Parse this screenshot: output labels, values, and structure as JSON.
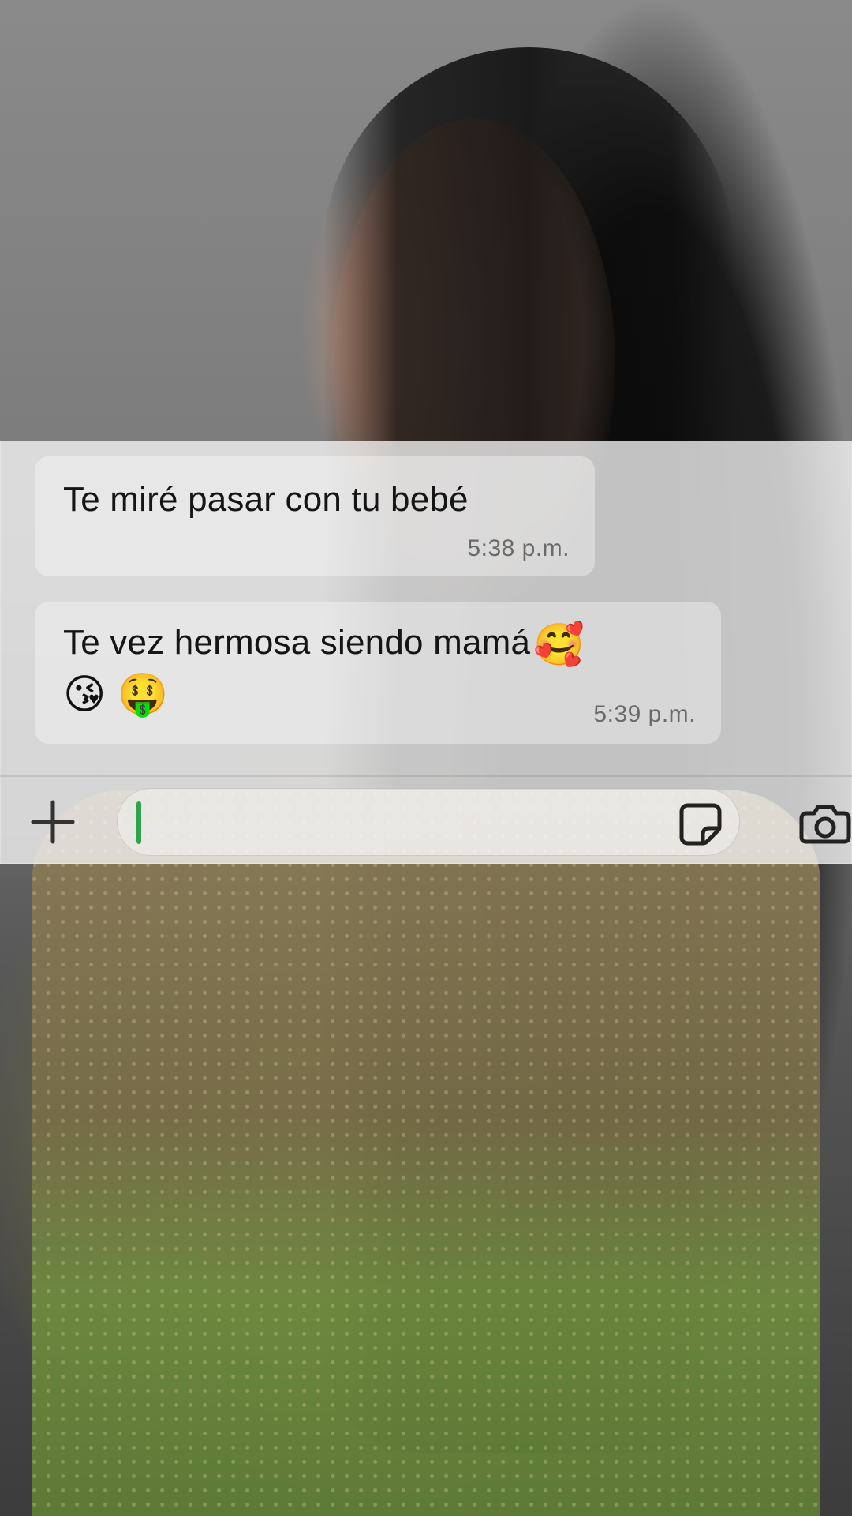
{
  "chat": {
    "messages": [
      {
        "text": "Te miré pasar con tu bebé",
        "time": "5:38 p.m."
      },
      {
        "text": "Te vez hermosa siendo mamá",
        "inline_emoji": "🥰",
        "emoji_line": "😘 🤑",
        "time": "5:39 p.m."
      }
    ]
  },
  "composer": {
    "value": "",
    "icons": {
      "left": "plus-icon",
      "sticker": "sticker-icon",
      "camera": "camera-icon"
    }
  },
  "colors": {
    "caret": "#2ea44f",
    "bubble_text": "#151515",
    "timestamp": "#6a6a6a"
  }
}
